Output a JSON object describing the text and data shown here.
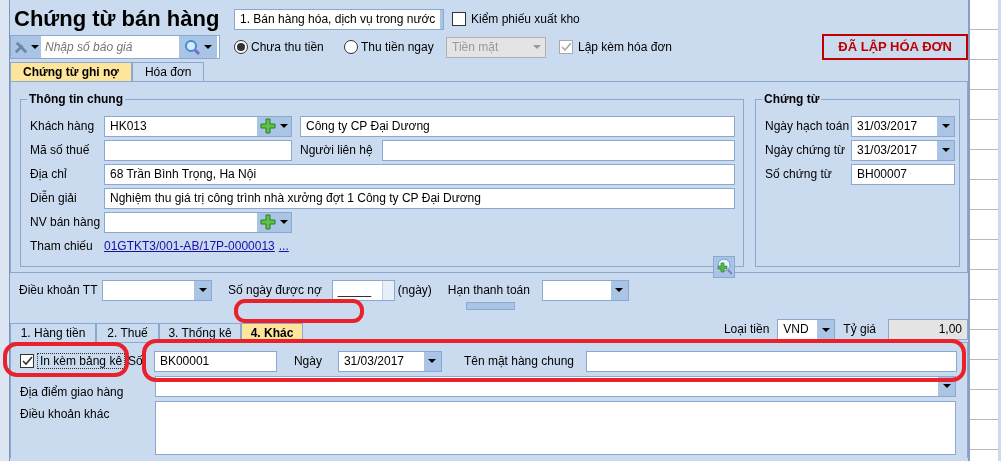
{
  "title": "Chứng từ bán hàng",
  "sale_type": {
    "value": "1. Bán hàng hóa, dịch vụ trong nước"
  },
  "export_slip": {
    "label": "Kiểm phiếu xuất kho",
    "checked": false
  },
  "quote_search": {
    "placeholder": "Nhập số báo giá"
  },
  "payment_options": [
    {
      "label": "Chưa thu tiền",
      "selected": true
    },
    {
      "label": "Thu tiền ngay",
      "selected": false
    }
  ],
  "payment_method": {
    "value": "Tiền mặt",
    "disabled": true
  },
  "invoice_option": {
    "label": "Lập kèm hóa đơn",
    "checked": true,
    "disabled": true
  },
  "stamp": "ĐÃ LẬP HÓA ĐƠN",
  "top_tabs": [
    {
      "label": "Chứng từ ghi nợ",
      "selected": true
    },
    {
      "label": "Hóa đơn",
      "selected": false
    }
  ],
  "general_info": {
    "title": "Thông tin chung",
    "customer": {
      "label": "Khách hàng",
      "code": "HK013",
      "name": "Công ty CP Đại Dương"
    },
    "tax_code": {
      "label": "Mã số thuế"
    },
    "contact": {
      "label": "Người liên hệ"
    },
    "address": {
      "label": "Địa chỉ",
      "value": "68 Trần Bình Trọng, Ha Nội"
    },
    "description": {
      "label": "Diễn giải",
      "value": "Nghiệm thu giá trị công trình nhà xưởng đợt 1 Công ty CP Đại Dương"
    },
    "salesperson": {
      "label": "NV bán hàng"
    },
    "reference": {
      "label": "Tham chiếu",
      "link": "01GTKT3/001-AB/17P-0000013",
      "more": "..."
    }
  },
  "voucher": {
    "title": "Chứng từ",
    "fields": [
      {
        "label": "Ngày hạch toán",
        "value": "31/03/2017",
        "kind": "date"
      },
      {
        "label": "Ngày chứng từ",
        "value": "31/03/2017",
        "kind": "date"
      },
      {
        "label": "Số chứng từ",
        "value": "BH00007",
        "kind": "text"
      }
    ]
  },
  "payment_terms": {
    "label": "Điều khoản TT",
    "days_label": "Số ngày được nợ",
    "days_value": "_____",
    "days_unit": "(ngày)",
    "due_label": "Hạn thanh toán"
  },
  "detail_tabs": [
    {
      "label": "1. Hàng tiền",
      "selected": false
    },
    {
      "label": "2. Thuế",
      "selected": false
    },
    {
      "label": "3. Thống kê",
      "selected": false
    },
    {
      "label": "4. Khác",
      "selected": true
    }
  ],
  "currency": {
    "label": "Loại tiền",
    "value": "VND",
    "rate_label": "Tỷ giá",
    "rate": "1,00"
  },
  "other": {
    "attach_list": {
      "label": "In kèm bảng kê",
      "checked": true
    },
    "number_label": "Số",
    "number": "BK00001",
    "date_label": "Ngày",
    "date": "31/03/2017",
    "item_name_label": "Tên mặt hàng chung",
    "delivery_label": "Địa điểm giao hàng",
    "other_terms_label": "Điều khoản khác"
  }
}
